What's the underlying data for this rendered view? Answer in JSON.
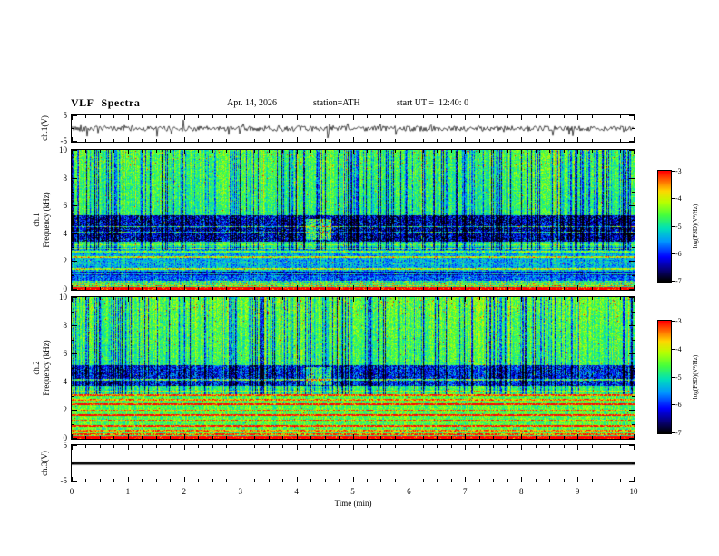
{
  "header": {
    "title": "VLF Spectra",
    "date": "Apr. 14, 2026",
    "station": "station=ATH",
    "start_ut": "start UT =  12:40: 0"
  },
  "x_axis": {
    "label": "Time (min)",
    "ticks": [
      0,
      1,
      2,
      3,
      4,
      5,
      6,
      7,
      8,
      9,
      10
    ],
    "range": [
      0,
      10
    ]
  },
  "panels": {
    "waveform": {
      "ylabel": "ch.1(V)",
      "yticks": [
        5,
        -5
      ],
      "yticks_minor": [
        0
      ],
      "ylim": [
        -5,
        5
      ]
    },
    "spec1": {
      "ylabel_line1": "ch.1",
      "ylabel_line2": "Frequency (kHz)",
      "yticks": [
        0,
        2,
        4,
        6,
        8,
        10
      ],
      "yticks_minor": [
        1,
        3,
        5,
        7,
        9
      ],
      "ylim": [
        0,
        10
      ]
    },
    "spec2": {
      "ylabel_line1": "ch.2",
      "ylabel_line2": "Frequency (kHz)",
      "yticks": [
        0,
        2,
        4,
        6,
        8,
        10
      ],
      "yticks_minor": [
        1,
        3,
        5,
        7,
        9
      ],
      "ylim": [
        0,
        10
      ]
    },
    "ch3": {
      "ylabel": "ch.3(V)",
      "yticks": [
        5,
        -5
      ],
      "yticks_minor": [
        0
      ],
      "ylim": [
        -5,
        5
      ]
    }
  },
  "colorbar": {
    "label": "log(PSD)(V²/Hz)",
    "ticks": [
      -3,
      -4,
      -5,
      -6,
      -7
    ],
    "range": [
      -7,
      -3
    ]
  },
  "colormap": {
    "stops": [
      [
        0,
        0,
        0,
        0
      ],
      [
        0.1,
        8,
        0,
        120
      ],
      [
        0.22,
        0,
        0,
        255
      ],
      [
        0.36,
        0,
        150,
        255
      ],
      [
        0.48,
        0,
        225,
        185
      ],
      [
        0.6,
        70,
        255,
        60
      ],
      [
        0.72,
        185,
        255,
        0
      ],
      [
        0.82,
        255,
        215,
        0
      ],
      [
        0.9,
        255,
        120,
        0
      ],
      [
        1,
        255,
        0,
        0
      ]
    ]
  },
  "chart_data": [
    {
      "type": "line",
      "name": "ch1-voltage-trace",
      "ylabel": "ch.1(V)",
      "ylim": [
        -5,
        5
      ],
      "xlim": [
        0,
        10
      ],
      "xlabel": "Time (min)",
      "description": "Broadband noisy voltage waveform fluctuating about 0 V with impulsive spikes reaching roughly ±4 V across the full 10 minutes",
      "render": {
        "seed": 42,
        "amp": 1.0,
        "spike_prob": 0.07,
        "spike_amp": 3.2
      }
    },
    {
      "type": "heatmap",
      "name": "ch1-spectrogram",
      "xlabel": "Time (min)",
      "xlim": [
        0,
        10
      ],
      "ylabel": "Frequency (kHz)",
      "ylim": [
        0,
        10
      ],
      "zlabel": "log(PSD)(V²/Hz)",
      "zlim": [
        -7,
        -3
      ],
      "colormap": "jet with black low end",
      "description": "0-10 kHz VLF spectrogram: green/cyan background near -5; bright red/orange band near 0 kHz; several enhanced horizontal lines below ~3 kHz; suppressed dark-blue band ~3.5-5.3 kHz containing narrow lines near 4.1 and 4.5 kHz; dense dark-blue vertical impulsive streaks above ~3 kHz; sparse red speckles near 9-10 kHz; brighter patch near 4.3 min between 4-5 kHz",
      "render": {
        "seed": 7,
        "base": -4.85,
        "noise": 0.5,
        "col_noise": 0.3,
        "streak_prob": 0.26,
        "streak_depth": [
          0.6,
          1.9
        ],
        "streak_min_f": 2.9,
        "bright_prob": 0.05,
        "top_tilt": 0.25,
        "dark_band": {
          "f0": 3.45,
          "f1": 5.35,
          "depth": 1.5
        },
        "lines": [
          {
            "f": 0.12,
            "w": 0.12,
            "boost": 2.4
          },
          {
            "f": 0.32,
            "w": 0.06,
            "boost": 1.2
          },
          {
            "f": 0.45,
            "w": 0.04,
            "boost": 1.5
          },
          {
            "f": 0.85,
            "w": 0.45,
            "boost": -0.9
          },
          {
            "f": 0.62,
            "w": 0.05,
            "boost": 1.0
          },
          {
            "f": 1.18,
            "w": 0.05,
            "boost": 1.1
          },
          {
            "f": 2.1,
            "w": 1.0,
            "boost": -0.55
          },
          {
            "f": 1.55,
            "w": 0.06,
            "boost": 1.3
          },
          {
            "f": 1.95,
            "w": 0.05,
            "boost": 1.0
          },
          {
            "f": 2.35,
            "w": 0.06,
            "boost": 1.4
          },
          {
            "f": 2.75,
            "w": 0.05,
            "boost": 0.9
          },
          {
            "f": 2.98,
            "w": 0.05,
            "boost": 1.1
          },
          {
            "f": 3.25,
            "w": 0.06,
            "boost": 0.6
          },
          {
            "f": 4.15,
            "w": 0.05,
            "boost": 1.2
          },
          {
            "f": 4.55,
            "w": 0.05,
            "boost": 1.5
          }
        ],
        "blob": {
          "x0": 4.15,
          "x1": 4.6,
          "f0": 3.6,
          "f1": 5.1,
          "boost": 1.5
        },
        "top_speckle": {
          "f_min": 8.6,
          "prob": 0.012,
          "value": -3.2
        },
        "hot_prob": 0.003
      }
    },
    {
      "type": "heatmap",
      "name": "ch2-spectrogram",
      "xlabel": "Time (min)",
      "xlim": [
        0,
        10
      ],
      "ylabel": "Frequency (kHz)",
      "ylim": [
        0,
        10
      ],
      "zlabel": "log(PSD)(V²/Hz)",
      "zlim": [
        -7,
        -3
      ],
      "colormap": "jet with black low end",
      "description": "0-10 kHz VLF spectrogram similar to ch.1 but brighter below 3 kHz with more orange/yellow horizontal lines; suppressed dark band ~3.8-5.2 kHz with enhanced line near 4.2 kHz; dark-blue vertical streaks above ~3 kHz; red speckles near 9-10 kHz; brighter patch near 4.3 min between 4-5 kHz",
      "render": {
        "seed": 13,
        "base": -4.75,
        "noise": 0.5,
        "col_noise": 0.3,
        "streak_prob": 0.25,
        "streak_depth": [
          0.6,
          1.9
        ],
        "streak_min_f": 3.2,
        "bright_prob": 0.05,
        "top_tilt": 0.25,
        "dark_band": {
          "f0": 3.75,
          "f1": 5.25,
          "depth": 1.3
        },
        "lines": [
          {
            "f": 0.12,
            "w": 0.12,
            "boost": 2.4
          },
          {
            "f": 0.35,
            "w": 0.05,
            "boost": 1.5
          },
          {
            "f": 0.6,
            "w": 0.05,
            "boost": 1.1
          },
          {
            "f": 0.95,
            "w": 0.06,
            "boost": 1.6
          },
          {
            "f": 1.35,
            "w": 0.06,
            "boost": 1.2
          },
          {
            "f": 1.7,
            "w": 0.06,
            "boost": 1.7
          },
          {
            "f": 2.05,
            "w": 0.05,
            "boost": 1.2
          },
          {
            "f": 2.45,
            "w": 0.06,
            "boost": 1.8
          },
          {
            "f": 2.8,
            "w": 0.05,
            "boost": 1.1
          },
          {
            "f": 3.1,
            "w": 0.05,
            "boost": 1.4
          },
          {
            "f": 3.4,
            "w": 0.05,
            "boost": 0.8
          },
          {
            "f": 4.2,
            "w": 0.06,
            "boost": 1.4
          },
          {
            "f": 1.8,
            "w": 1.4,
            "boost": 0.15
          }
        ],
        "blob": {
          "x0": 4.15,
          "x1": 4.6,
          "f0": 3.8,
          "f1": 5.1,
          "boost": 1.3
        },
        "top_speckle": {
          "f_min": 8.6,
          "prob": 0.012,
          "value": -3.2
        },
        "hot_prob": 0.004
      }
    },
    {
      "type": "line",
      "name": "ch3-voltage-trace",
      "ylabel": "ch.3(V)",
      "ylim": [
        -5,
        5
      ],
      "xlim": [
        0,
        10
      ],
      "xlabel": "Time (min)",
      "description": "Flat thick black line at 0 V for the entire 10 minutes (no signal on channel 3)",
      "render": {
        "value": 0,
        "thickness": 3
      }
    }
  ]
}
